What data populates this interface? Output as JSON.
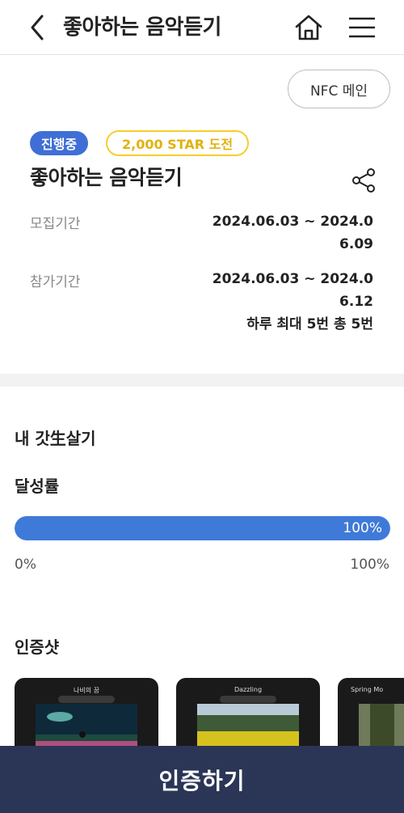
{
  "header": {
    "title": "좋아하는 음악듣기",
    "back_icon": "chevron-left-icon",
    "home_icon": "home-icon",
    "menu_icon": "hamburger-menu-icon"
  },
  "nfc_button": "NFC 메인",
  "badges": {
    "status": "진행중",
    "challenge": "2,000 STAR 도전"
  },
  "event": {
    "title": "좋아하는 음악듣기",
    "share_icon": "share-icon",
    "recruit_label": "모집기간",
    "recruit_value": "2024.06.03 ~ 2024.06.09",
    "participate_label": "참가기간",
    "participate_value": "2024.06.03 ~ 2024.06.12",
    "daily_limit": "하루 최대 5번 총 5번"
  },
  "my_section": {
    "title": "내 갓生살기",
    "achievement_label": "달성률",
    "progress_percent": 100,
    "progress_text": "100%",
    "axis_min": "0%",
    "axis_max": "100%"
  },
  "shots_section": {
    "title": "인증샷",
    "shots": [
      {
        "caption": "나비의 꿈"
      },
      {
        "caption": "Dazzling"
      },
      {
        "caption": "Spring Mo"
      }
    ]
  },
  "cta": "인증하기",
  "colors": {
    "accent": "#3f7ad8",
    "badge_blue": "#3f6fd6",
    "badge_yellow": "#f5cf2c",
    "cta_bg": "#2b3556"
  }
}
